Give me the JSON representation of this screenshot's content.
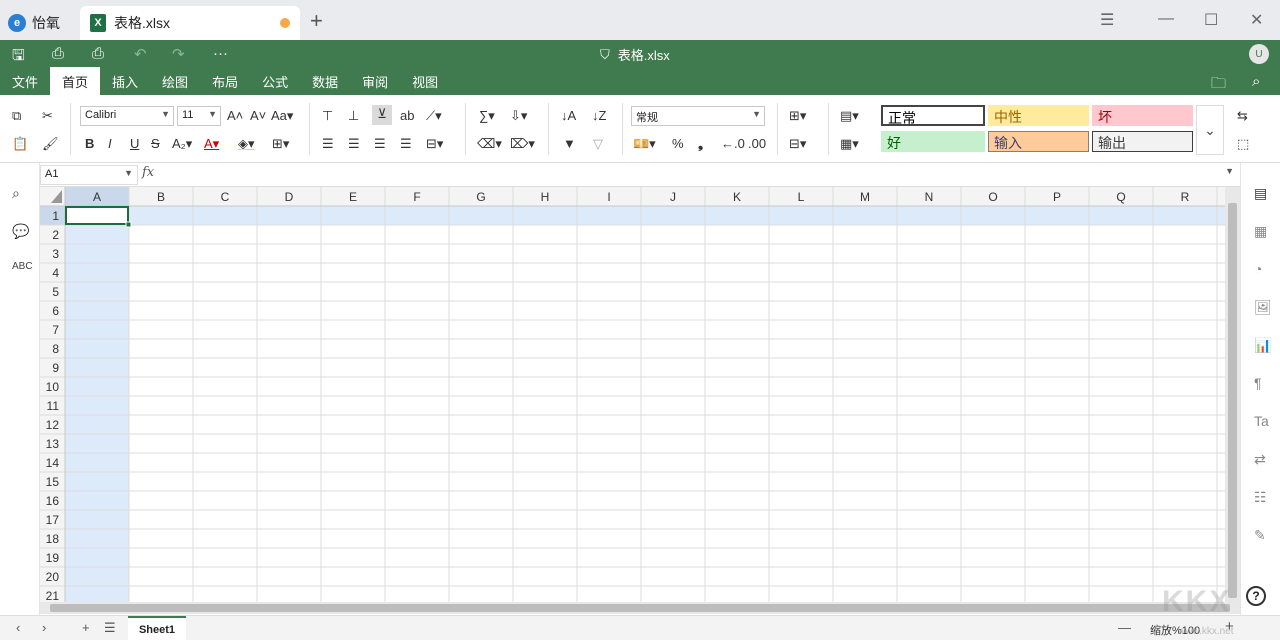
{
  "app": {
    "name": "怡氧",
    "logo_letter": "e"
  },
  "tab": {
    "title": "表格.xlsx",
    "icon": "X"
  },
  "window": {
    "menu_icon": "☰",
    "minimize": "—",
    "maximize": "☐",
    "close": "✕"
  },
  "ribbon": {
    "doc_title": "表格.xlsx",
    "user_initial": "U",
    "menus": [
      "文件",
      "首页",
      "插入",
      "绘图",
      "布局",
      "公式",
      "数据",
      "审阅",
      "视图"
    ],
    "active_menu": "首页"
  },
  "toolbar": {
    "font_name": "Calibri",
    "font_size": "11",
    "number_format": "常规",
    "percent": "%",
    "comma": "❟"
  },
  "styles": [
    {
      "label": "正常",
      "bg": "#ffffff",
      "fg": "#000000",
      "border": "#444444"
    },
    {
      "label": "中性",
      "bg": "#ffeb9c",
      "fg": "#9c6500",
      "border": "#ffeb9c"
    },
    {
      "label": "坏",
      "bg": "#ffc7ce",
      "fg": "#9c0006",
      "border": "#ffc7ce"
    },
    {
      "label": "好",
      "bg": "#c6efce",
      "fg": "#006100",
      "border": "#c6efce"
    },
    {
      "label": "输入",
      "bg": "#ffcc99",
      "fg": "#3f3f76",
      "border": "#7f7f7f"
    },
    {
      "label": "输出",
      "bg": "#f2f2f2",
      "fg": "#3f3f3f",
      "border": "#3f3f3f"
    }
  ],
  "formula": {
    "cell_ref": "A1",
    "fx": "fx",
    "value": ""
  },
  "sheet": {
    "columns": [
      "A",
      "B",
      "C",
      "D",
      "E",
      "F",
      "G",
      "H",
      "I",
      "J",
      "K",
      "L",
      "M",
      "N",
      "O",
      "P",
      "Q",
      "R"
    ],
    "rows": [
      "1",
      "2",
      "3",
      "4",
      "5",
      "6",
      "7",
      "8",
      "9",
      "10",
      "11",
      "12",
      "13",
      "14",
      "15",
      "16",
      "17",
      "18",
      "19",
      "20",
      "21"
    ],
    "selected_cell": "A1"
  },
  "status": {
    "sheet_name": "Sheet1",
    "zoom_label": "缩放%100",
    "zoom_out": "—",
    "zoom_in": "+"
  },
  "watermark": {
    "text": "KKX",
    "sub": "www.kkx.net"
  },
  "colors": {
    "accent": "#3f7b4e",
    "selection": "#ddeaf9",
    "header_selected": "#c9d8ea"
  }
}
